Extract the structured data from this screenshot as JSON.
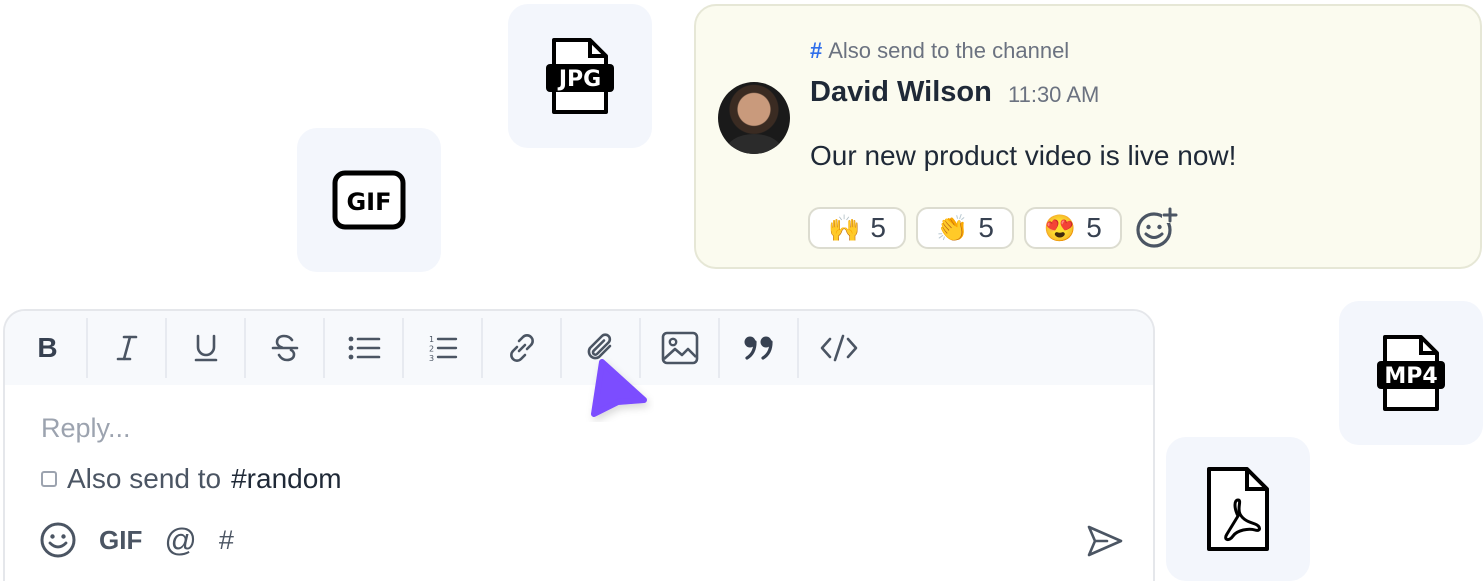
{
  "files": {
    "jpg_label": "JPG",
    "gif_label": "GIF",
    "mp4_label": "MP4",
    "pdf_icon": "pdf-file-icon"
  },
  "message": {
    "channel_note": "Also send to the channel",
    "author": "David Wilson",
    "time": "11:30 AM",
    "text": "Our new product video is live now!",
    "reactions": [
      {
        "emoji": "🙌",
        "count": "5"
      },
      {
        "emoji": "👏",
        "count": "5"
      },
      {
        "emoji": "😍",
        "count": "5"
      }
    ]
  },
  "composer": {
    "toolbar": [
      "bold",
      "italic",
      "underline",
      "strikethrough",
      "bullet-list",
      "numbered-list",
      "link",
      "attachment",
      "image",
      "quote",
      "code"
    ],
    "bold_label": "B",
    "placeholder": "Reply...",
    "also_send_prefix": "Also send to",
    "also_send_channel": "#random",
    "gif_label": "GIF",
    "at_label": "@",
    "hash_label": "#"
  },
  "colors": {
    "cursor": "#7c4dff",
    "card_bg": "#fbfbef",
    "tile_bg": "#f3f6fc"
  }
}
